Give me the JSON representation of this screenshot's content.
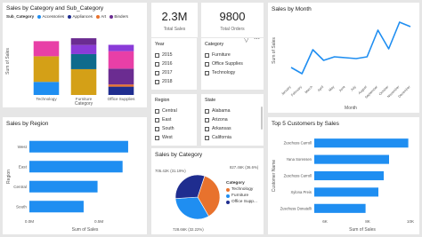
{
  "colors": {
    "blue": "#1f8ef1",
    "navy": "#1f2d8f",
    "orange": "#e8722d",
    "purple": "#6b2c91",
    "pink": "#e83fa7",
    "gold": "#d4a017",
    "sea": "#0e6b8c",
    "violet": "#8a3bd8"
  },
  "stacked": {
    "title": "Sales by Category and Sub_Category",
    "legend_label": "Sub_Category",
    "legend_items": [
      "Accessories",
      "Appliances",
      "Art",
      "Binders"
    ],
    "ylabel": "Sum of Sales",
    "xlabel": "Category"
  },
  "cards": {
    "total_sales": {
      "value": "2.3M",
      "label": "Total Sales"
    },
    "total_orders": {
      "value": "9800",
      "label": "Total Orders"
    }
  },
  "slicers": {
    "year": {
      "title": "Year",
      "items": [
        "2015",
        "2016",
        "2017",
        "2018"
      ]
    },
    "category": {
      "title": "Category",
      "items": [
        "Furniture",
        "Office Supplies",
        "Technology"
      ]
    },
    "region": {
      "title": "Region",
      "items": [
        "Central",
        "East",
        "South",
        "West"
      ]
    },
    "state": {
      "title": "State",
      "items": [
        "Alabama",
        "Arizona",
        "Arkansas",
        "California"
      ]
    }
  },
  "pie_legend": {
    "title": "Category",
    "items": [
      "Technology",
      "Furniture",
      "Office Supp..."
    ]
  },
  "chart_data": [
    {
      "type": "bar",
      "stacked": true,
      "title": "Sales by Category and Sub_Category",
      "xlabel": "Category",
      "ylabel": "Sum of Sales",
      "categories": [
        "Technology",
        "Furniture",
        "Office Supplies"
      ],
      "series": [
        {
          "name": "Accessories",
          "values": [
            165000,
            0,
            0
          ]
        },
        {
          "name": "Appliances",
          "values": [
            0,
            0,
            105000
          ]
        },
        {
          "name": "Art",
          "values": [
            0,
            0,
            27000
          ]
        },
        {
          "name": "Binders",
          "values": [
            0,
            0,
            200000
          ]
        },
        {
          "values": [
            323000,
            325000,
            0
          ]
        },
        {
          "values": [
            190000,
            0,
            0
          ]
        },
        {
          "values": [
            0,
            190000,
            0
          ]
        },
        {
          "values": [
            0,
            115000,
            0
          ]
        },
        {
          "values": [
            0,
            85000,
            0
          ]
        },
        {
          "values": [
            0,
            0,
            220000
          ]
        },
        {
          "values": [
            0,
            0,
            80000
          ]
        }
      ],
      "ylim": [
        0,
        850000
      ],
      "grid": false,
      "legend_position": "top"
    },
    {
      "type": "line",
      "title": "Sales by Month",
      "xlabel": "Month",
      "ylabel": "Sum of Sales",
      "categories": [
        "January",
        "February",
        "March",
        "April",
        "May",
        "June",
        "July",
        "August",
        "September",
        "October",
        "November",
        "December"
      ],
      "values": [
        95000,
        60000,
        195000,
        135000,
        155000,
        150000,
        145000,
        155000,
        305000,
        200000,
        350000,
        325000
      ],
      "ylim": [
        0,
        380000
      ],
      "grid": false
    },
    {
      "type": "bar",
      "orientation": "horizontal",
      "title": "Sales by Region",
      "xlabel": "Sum of Sales",
      "ylabel": "Region",
      "categories": [
        "West",
        "East",
        "Central",
        "South"
      ],
      "values": [
        710000,
        670000,
        490000,
        390000
      ],
      "xlim": [
        0,
        800000
      ],
      "x_tick_labels": [
        "0.0M",
        "0.5M"
      ],
      "grid": false
    },
    {
      "type": "pie",
      "title": "Sales by Category",
      "categories": [
        "Technology",
        "Furniture",
        "Office Supplies"
      ],
      "values": [
        827.46,
        728.66,
        705.42
      ],
      "data_labels": [
        "827.46K (36.6%)",
        "728.66K (32.22%)",
        "705.42K (31.19%)"
      ],
      "legend_position": "right"
    },
    {
      "type": "bar",
      "orientation": "horizontal",
      "title": "Top 5 Customers by Sales",
      "xlabel": "Sum of Sales",
      "ylabel": "Customer Name",
      "categories": [
        "Zuschuss Carroll",
        "Yana Sorensen",
        "Zuschuss Carroll",
        "Xylona Preis",
        "Zuschuss Donatelli"
      ],
      "values": [
        9900,
        9000,
        8750,
        8500,
        7900
      ],
      "xlim": [
        5500,
        10000
      ],
      "x_tick_labels": [
        "6K",
        "8K",
        "10K"
      ],
      "grid": false
    }
  ]
}
